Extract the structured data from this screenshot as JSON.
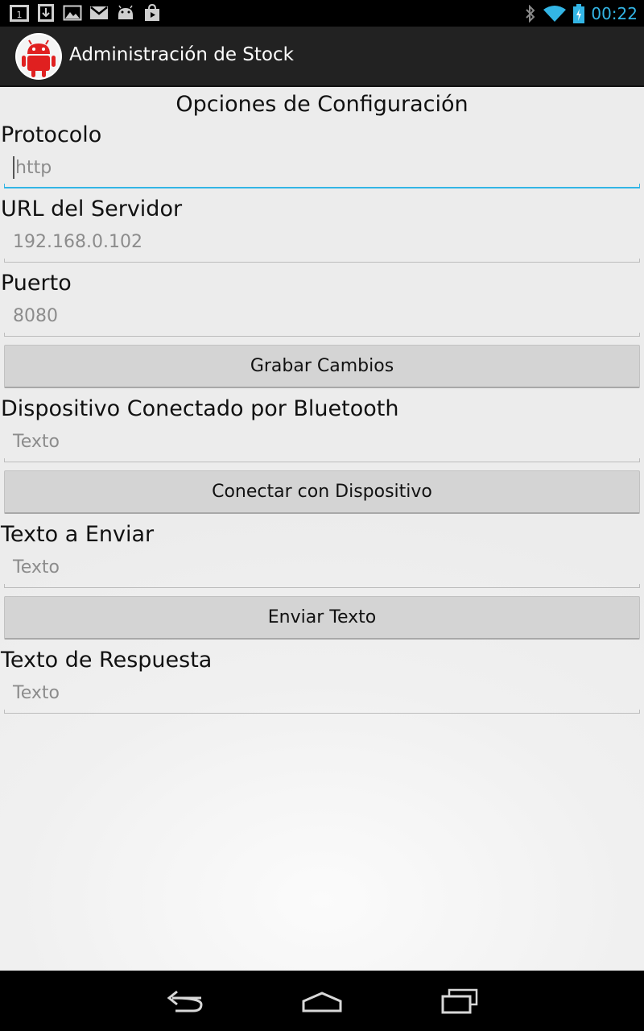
{
  "status_bar": {
    "time": "00:22",
    "notification_icons": [
      "calendar-icon",
      "download-icon",
      "image-icon",
      "gmail-icon",
      "android-icon",
      "play-store-icon"
    ],
    "system_icons": [
      "bluetooth-icon",
      "wifi-icon",
      "battery-charging-icon"
    ]
  },
  "action_bar": {
    "title": "Administración de Stock",
    "icon": "android-robot-icon"
  },
  "form": {
    "section_title": "Opciones de Configuración",
    "protocol_label": "Protocolo",
    "protocol_value": "http",
    "server_label": "URL del Servidor",
    "server_value": "192.168.0.102",
    "port_label": "Puerto",
    "port_value": "8080",
    "save_button": "Grabar Cambios",
    "bt_label": "Dispositivo Conectado por Bluetooth",
    "bt_placeholder": "Texto",
    "connect_button": "Conectar con Dispositivo",
    "send_label": "Texto a Enviar",
    "send_placeholder": "Texto",
    "send_button": "Enviar Texto",
    "response_label": "Texto de Respuesta",
    "response_placeholder": "Texto"
  },
  "nav_bar": {
    "buttons": [
      "back-icon",
      "home-icon",
      "recent-apps-icon"
    ]
  },
  "colors": {
    "accent": "#33b5e5",
    "action_bar": "#222222",
    "button": "#d4d4d4"
  }
}
